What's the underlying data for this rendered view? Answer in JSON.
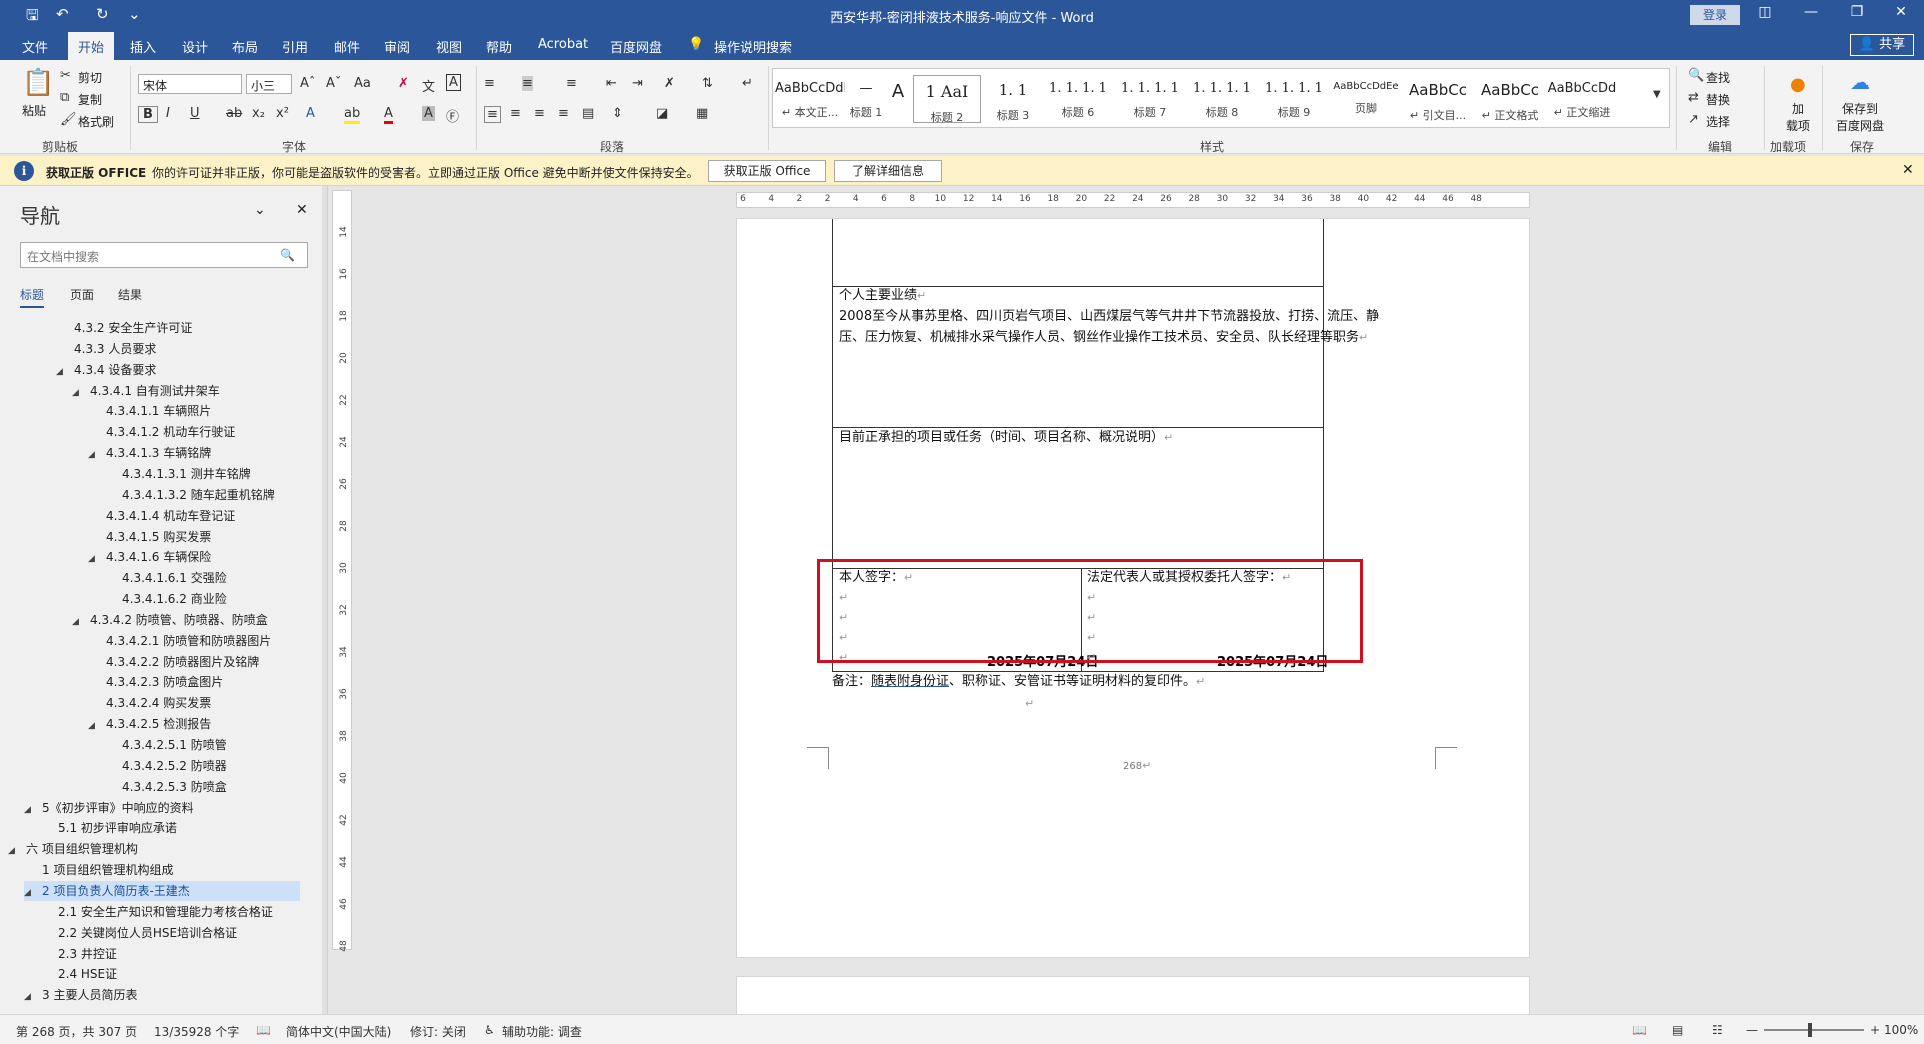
{
  "titlebar": {
    "title": "西安华邦-密闭排液技术服务-响应文件  -  Word",
    "login": "登录"
  },
  "menu": {
    "tabs": [
      "文件",
      "开始",
      "插入",
      "设计",
      "布局",
      "引用",
      "邮件",
      "审阅",
      "视图",
      "帮助",
      "Acrobat",
      "百度网盘"
    ],
    "active": "开始",
    "tell_me": "操作说明搜索",
    "share": "共享"
  },
  "ribbon": {
    "clipboard": {
      "paste": "粘贴",
      "cut": "剪切",
      "copy": "复制",
      "format_painter": "格式刷",
      "label": "剪贴板"
    },
    "font": {
      "name": "宋体",
      "size": "小三",
      "label": "字体"
    },
    "paragraph": {
      "label": "段落"
    },
    "styles": {
      "label": "样式",
      "items": [
        {
          "sample": "AaBbCcDdI",
          "name": "↵ 本文正..."
        },
        {
          "sample": "—",
          "name": "标题 1"
        },
        {
          "sample": "A",
          "name": ""
        },
        {
          "sample": "1  AaI",
          "name": "标题 2"
        },
        {
          "sample": "1. 1",
          "name": "标题 3"
        },
        {
          "sample": "1. 1. 1. 1",
          "name": "标题 6"
        },
        {
          "sample": "1. 1. 1. 1",
          "name": "标题 7"
        },
        {
          "sample": "1. 1. 1. 1",
          "name": "标题 8"
        },
        {
          "sample": "1. 1. 1. 1",
          "name": "标题 9"
        },
        {
          "sample": "AaBbCcDdEe",
          "name": "页脚"
        },
        {
          "sample": "AaBbCc",
          "name": "↵ 引文目..."
        },
        {
          "sample": "AaBbCc",
          "name": "↵ 正文格式"
        },
        {
          "sample": "AaBbCcDd",
          "name": "↵ 正文缩进"
        }
      ]
    },
    "editing": {
      "find": "查找",
      "replace": "替换",
      "select": "选择",
      "label": "编辑"
    },
    "addins": {
      "btn": "加\n载项",
      "label": "加载项"
    },
    "save": {
      "btn": "保存到\n百度网盘",
      "label": "保存"
    }
  },
  "infobar": {
    "title": "获取正版 OFFICE",
    "message": "你的许可证并非正版，你可能是盗版软件的受害者。立即通过正版 Office 避免中断并使文件保持安全。",
    "btn_genuine": "获取正版 Office",
    "btn_learn": "了解详细信息"
  },
  "nav": {
    "title": "导航",
    "search_placeholder": "在文档中搜索",
    "tabs": [
      "标题",
      "页面",
      "结果"
    ],
    "items": [
      {
        "text": "4.3.2 安全生产许可证",
        "level": 4,
        "tri": ""
      },
      {
        "text": "4.3.3 人员要求",
        "level": 4,
        "tri": ""
      },
      {
        "text": "4.3.4 设备要求",
        "level": 4,
        "tri": "◢"
      },
      {
        "text": "4.3.4.1 自有测试井架车",
        "level": 5,
        "tri": "◢"
      },
      {
        "text": "4.3.4.1.1 车辆照片",
        "level": 6,
        "tri": ""
      },
      {
        "text": "4.3.4.1.2 机动车行驶证",
        "level": 6,
        "tri": ""
      },
      {
        "text": "4.3.4.1.3 车辆铭牌",
        "level": 6,
        "tri": "◢"
      },
      {
        "text": "4.3.4.1.3.1 测井车铭牌",
        "level": 7,
        "tri": ""
      },
      {
        "text": "4.3.4.1.3.2 随车起重机铭牌",
        "level": 7,
        "tri": ""
      },
      {
        "text": "4.3.4.1.4 机动车登记证",
        "level": 6,
        "tri": ""
      },
      {
        "text": "4.3.4.1.5 购买发票",
        "level": 6,
        "tri": ""
      },
      {
        "text": "4.3.4.1.6 车辆保险",
        "level": 6,
        "tri": "◢"
      },
      {
        "text": "4.3.4.1.6.1 交强险",
        "level": 7,
        "tri": ""
      },
      {
        "text": "4.3.4.1.6.2 商业险",
        "level": 7,
        "tri": ""
      },
      {
        "text": "4.3.4.2 防喷管、防喷器、防喷盒",
        "level": 5,
        "tri": "◢"
      },
      {
        "text": "4.3.4.2.1 防喷管和防喷器图片",
        "level": 6,
        "tri": ""
      },
      {
        "text": "4.3.4.2.2 防喷器图片及铭牌",
        "level": 6,
        "tri": ""
      },
      {
        "text": "4.3.4.2.3 防喷盒图片",
        "level": 6,
        "tri": ""
      },
      {
        "text": "4.3.4.2.4 购买发票",
        "level": 6,
        "tri": ""
      },
      {
        "text": "4.3.4.2.5 检测报告",
        "level": 6,
        "tri": "◢"
      },
      {
        "text": "4.3.4.2.5.1 防喷管",
        "level": 7,
        "tri": ""
      },
      {
        "text": "4.3.4.2.5.2 防喷器",
        "level": 7,
        "tri": ""
      },
      {
        "text": "4.3.4.2.5.3 防喷盒",
        "level": 7,
        "tri": ""
      },
      {
        "text": "5《初步评审》中响应的资料",
        "level": 2,
        "tri": "◢"
      },
      {
        "text": "5.1 初步评审响应承诺",
        "level": 3,
        "tri": ""
      },
      {
        "text": "六 项目组织管理机构",
        "level": 1,
        "tri": "◢"
      },
      {
        "text": "1 项目组织管理机构组成",
        "level": 2,
        "tri": ""
      },
      {
        "text": "2 项目负责人简历表-王建杰",
        "level": 2,
        "tri": "◢",
        "selected": true
      },
      {
        "text": "2.1 安全生产知识和管理能力考核合格证",
        "level": 3,
        "tri": ""
      },
      {
        "text": "2.2 关键岗位人员HSE培训合格证",
        "level": 3,
        "tri": ""
      },
      {
        "text": "2.3 井控证",
        "level": 3,
        "tri": ""
      },
      {
        "text": "2.4 HSE证",
        "level": 3,
        "tri": ""
      },
      {
        "text": "3 主要人员简历表",
        "level": 2,
        "tri": "◢"
      }
    ]
  },
  "ruler": {
    "h_ticks": [
      "6",
      "4",
      "2",
      "2",
      "4",
      "6",
      "8",
      "10",
      "12",
      "14",
      "16",
      "18",
      "20",
      "22",
      "24",
      "26",
      "28",
      "30",
      "32",
      "34",
      "36",
      "38",
      "40",
      "42",
      "44",
      "46",
      "48"
    ],
    "v_ticks": [
      "14",
      "16",
      "18",
      "20",
      "22",
      "24",
      "26",
      "28",
      "30",
      "32",
      "34",
      "36",
      "38",
      "40",
      "42",
      "44",
      "46",
      "48"
    ]
  },
  "document": {
    "achievements_title": "个人主要业绩",
    "achievements_line1": "2008至今从事苏里格、四川页岩气项目、山西煤层气等气井井下节流器投放、打捞、流压、静",
    "achievements_line2": "压、压力恢复、机械排水采气操作人员、钢丝作业操作工技术员、安全员、队长经理等职务",
    "current_projects": "目前正承担的项目或任务（时间、项目名称、概况说明）",
    "sign_self": "本人签字：",
    "sign_legal": "法定代表人或其授权委托人签字：",
    "date_left": "2025年07月24日",
    "date_right": "2025年07月24日",
    "remark_prefix": "备注：",
    "remark_link": "随表附身份证",
    "remark_rest": "、职称证、安管证书等证明材料的复印件。",
    "page_number": "268"
  },
  "statusbar": {
    "page": "第 268 页，共 307 页",
    "words": "13/35928 个字",
    "language": "简体中文(中国大陆)",
    "track": "修订: 关闭",
    "accessibility": "辅助功能: 调查",
    "zoom": "100%"
  },
  "colors": {
    "accent": "#2b579a",
    "highlight_border": "#d0101c",
    "infobar_bg": "#fdf2c7"
  }
}
